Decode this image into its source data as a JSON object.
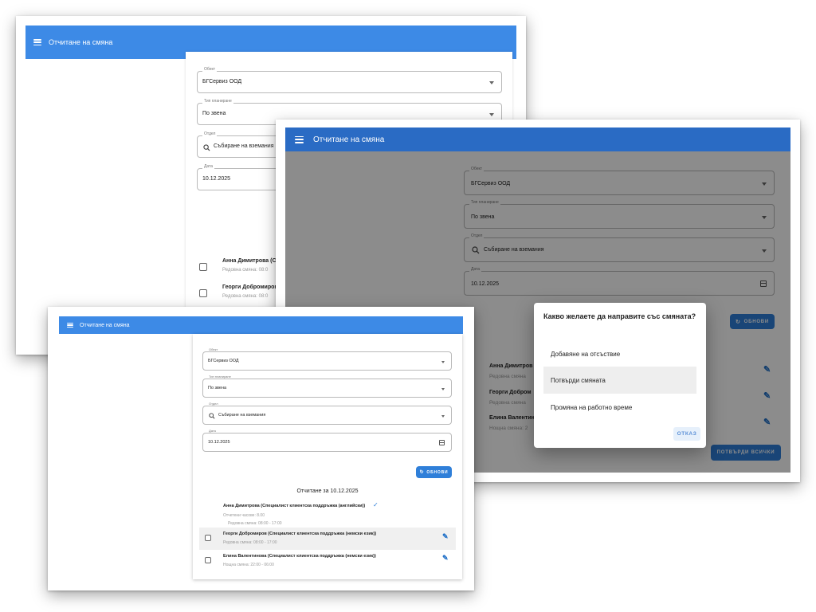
{
  "app": {
    "title": "Отчитане на смяна"
  },
  "form": {
    "site": {
      "label": "Обект",
      "value": "БГСервиз ООД"
    },
    "planning_type": {
      "label": "Тип планиране",
      "value": "По звена"
    },
    "department": {
      "label": "Отдел",
      "value": "Събиране на вземания"
    },
    "date": {
      "label": "Дата",
      "value": "10.12.2025"
    }
  },
  "actions": {
    "refresh": "ОБНОВИ",
    "confirm_all": "ПОТВЪРДИ ВСИЧКИ"
  },
  "report": {
    "heading": "Отчитане за 10.12.2025",
    "employees": [
      {
        "name": "Анна Димитрова (Специалист клиентска поддръжка (английски))",
        "short": "Анна Димитрова (Сп",
        "short2": "Анна Димитров",
        "reported": "Отчетени часове: 8.00",
        "shift": "Редовна смяна: 08:00 - 17:00",
        "shift_short": "Редовна смяна: 08:0",
        "shift_short2": "Редовна смяна",
        "status": "reported"
      },
      {
        "name": "Георги Добромиров (Специалист клиентска поддръжка (немски език))",
        "short": "Георги Добромиров",
        "short2": "Георги Добром",
        "shift": "Редовна смяна: 08:00 - 17:00",
        "shift_short": "Редовна смяна: 08:0",
        "shift_short2": "Редовна смяна",
        "status": "pending"
      },
      {
        "name": "Елина Валентинова (Специалист клиентска поддръжка (немски език))",
        "short2": "Елина Валентин",
        "shift": "Нощна смяна: 22:00 - 06:00",
        "shift_short2": "Нощна смяна: 2",
        "status": "pending"
      }
    ]
  },
  "dialog": {
    "title": "Какво желаете да направите със смяната?",
    "options": [
      "Добавяне на отсъствие",
      "Потвърди смяната",
      "Промяна на работно време"
    ],
    "selected_index": 1,
    "cancel": "ОТКАЗ"
  },
  "colors": {
    "appbar": "#3d8ae6",
    "appbar_dark": "#2a6bc4",
    "accent": "#2f7fd9",
    "edit": "#1f6fc7"
  },
  "icons": {
    "menu": "menu-icon",
    "search": "search-icon",
    "calendar": "calendar-icon",
    "dropdown": "chevron-down-icon",
    "edit": "pencil-icon",
    "check": "check-icon",
    "refresh": "refresh-icon"
  }
}
